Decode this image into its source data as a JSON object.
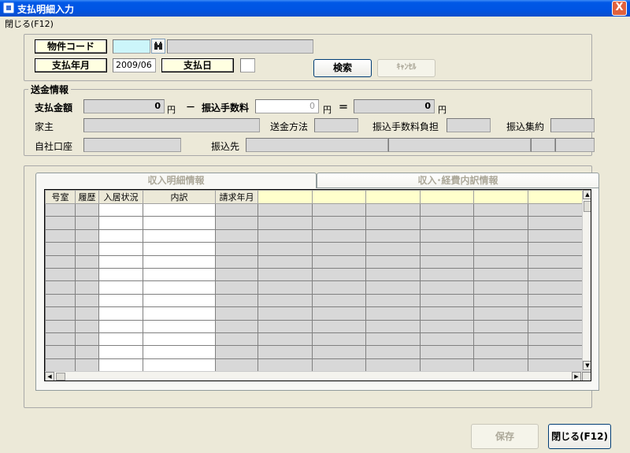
{
  "window": {
    "title": "支払明細入力",
    "close_glyph": "X"
  },
  "menu": {
    "close_label": "閉じる(F12)"
  },
  "search": {
    "property_code_label": "物件コード",
    "property_code_value": "",
    "property_name_value": "",
    "pay_month_label": "支払年月",
    "pay_month_value": "2009/06",
    "pay_day_label": "支払日",
    "pay_day_value": "",
    "search_button": "検索",
    "cancel_button": "ｷｬﾝｾﾙ"
  },
  "remit": {
    "legend": "送金情報",
    "pay_amount_label": "支払金額",
    "pay_amount_value": "0",
    "yen": "円",
    "minus": "－",
    "fee_label": "振込手数料",
    "fee_value": "0",
    "equals": "＝",
    "net_value": "0",
    "owner_label": "家主",
    "method_label": "送金方法",
    "fee_burden_label": "振込手数料負担",
    "transfer_batch_label": "振込集約",
    "own_account_label": "自社口座",
    "destination_label": "振込先"
  },
  "tabs": [
    {
      "label": "収入明細情報"
    },
    {
      "label": "収入･経費内訳情報"
    }
  ],
  "grid": {
    "columns": [
      "号室",
      "履歴",
      "入居状況",
      "内訳",
      "請求年月",
      "",
      "",
      "",
      "",
      "",
      ""
    ]
  },
  "footer": {
    "save_label": "保存",
    "close_label": "閉じる(F12)"
  }
}
